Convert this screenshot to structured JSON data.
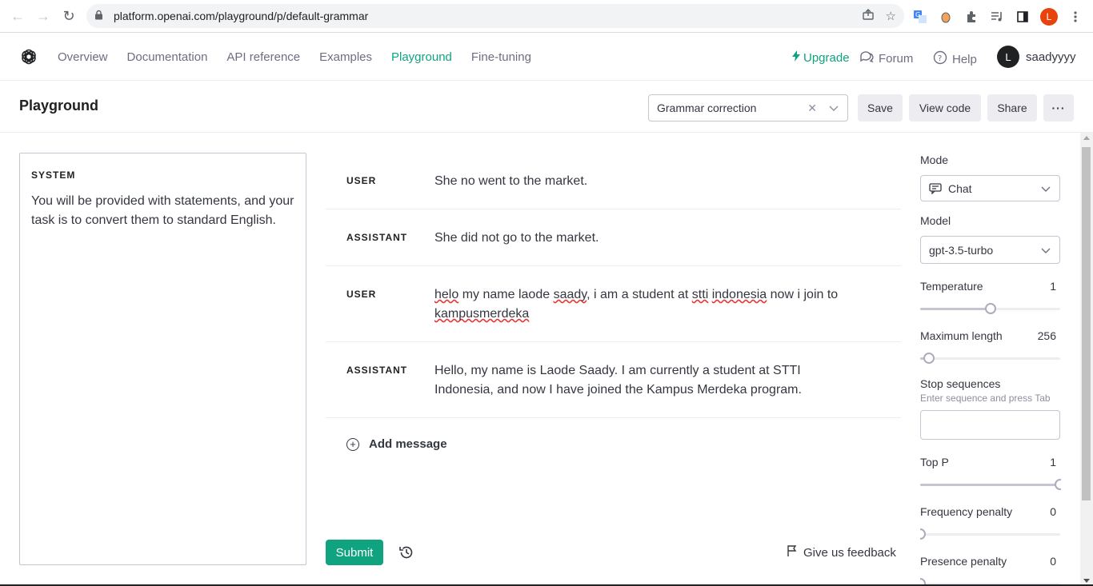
{
  "browser": {
    "url": "platform.openai.com/playground/p/default-grammar",
    "profile_initial": "L"
  },
  "site": {
    "nav": [
      "Overview",
      "Documentation",
      "API reference",
      "Examples",
      "Playground",
      "Fine-tuning"
    ],
    "active_nav": "Playground",
    "upgrade": "Upgrade",
    "forum": "Forum",
    "help": "Help",
    "user_initial": "L",
    "username": "saadyyyy",
    "accent_color": "#10a37f"
  },
  "playground": {
    "title": "Playground",
    "preset": "Grammar correction",
    "save": "Save",
    "view_code": "View code",
    "share": "Share",
    "more": "···"
  },
  "system": {
    "label": "SYSTEM",
    "text": "You will be provided with statements, and your task is to convert them to standard English."
  },
  "messages": [
    {
      "role": "USER",
      "content": "She no went to the market."
    },
    {
      "role": "ASSISTANT",
      "content": "She did not go to the market."
    },
    {
      "role": "USER",
      "content": "helo my name laode saady, i am a student at stti indonesia now i join to kampusmerdeka"
    },
    {
      "role": "ASSISTANT",
      "content": "Hello, my name is Laode Saady. I am currently a student at STTI Indonesia, and now I have joined the Kampus Merdeka program."
    }
  ],
  "add_message": "Add message",
  "submit": "Submit",
  "feedback": "Give us feedback",
  "settings": {
    "mode_label": "Mode",
    "mode_value": "Chat",
    "model_label": "Model",
    "model_value": "gpt-3.5-turbo",
    "temperature_label": "Temperature",
    "temperature_value": "1",
    "temperature_fraction": 0.5,
    "max_length_label": "Maximum length",
    "max_length_value": "256",
    "max_length_fraction": 0.06,
    "stop_label": "Stop sequences",
    "stop_hint": "Enter sequence and press Tab",
    "top_p_label": "Top P",
    "top_p_value": "1",
    "top_p_fraction": 1.0,
    "freq_label": "Frequency penalty",
    "freq_value": "0",
    "freq_fraction": 0.0,
    "presence_label": "Presence penalty",
    "presence_value": "0",
    "presence_fraction": 0.0
  }
}
